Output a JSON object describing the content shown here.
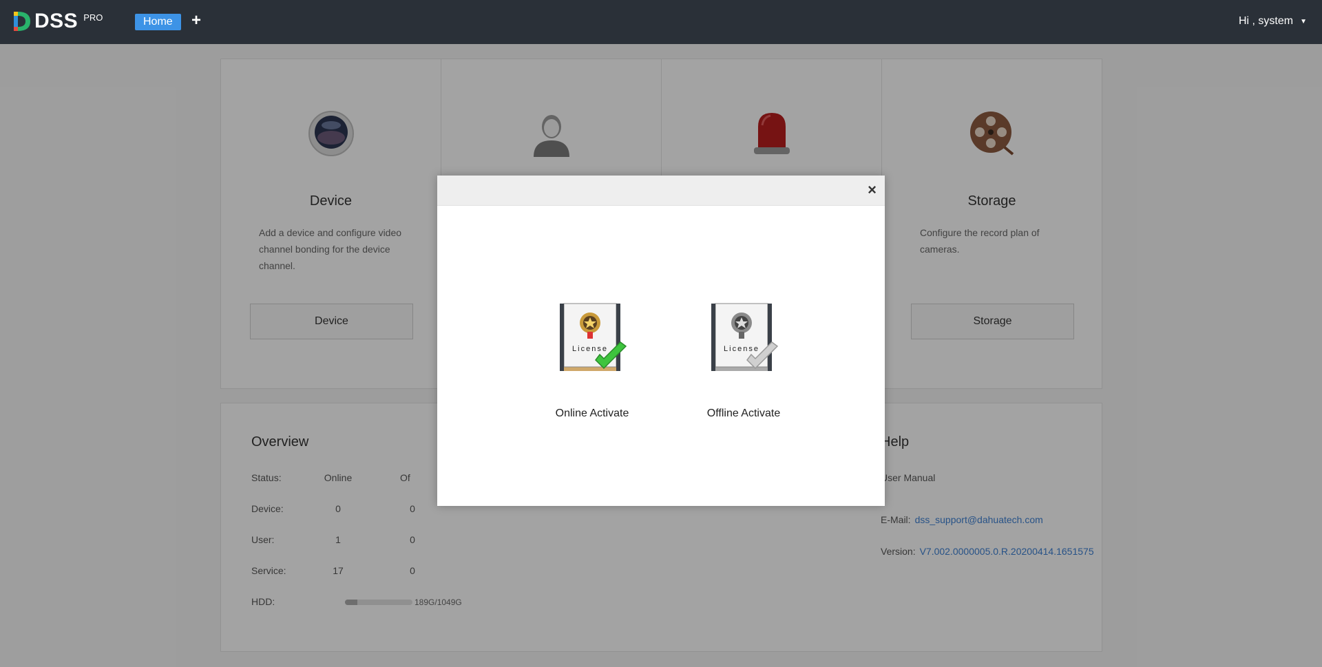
{
  "header": {
    "logo_text": "DSS",
    "logo_suffix": "PRO",
    "home_tab": "Home",
    "add_tab": "+",
    "user_greeting": "Hi , system"
  },
  "cards": [
    {
      "title": "Device",
      "desc": "Add a device and configure video channel bonding for the device channel.",
      "button": "Device",
      "icon": "camera-icon"
    },
    {
      "title": "",
      "desc": "",
      "button": "",
      "icon": "user-icon"
    },
    {
      "title": "",
      "desc": "",
      "button": "",
      "icon": "alarm-icon"
    },
    {
      "title": "Storage",
      "desc": "Configure the record plan of cameras.",
      "button": "Storage",
      "icon": "film-reel-icon"
    }
  ],
  "overview": {
    "title": "Overview",
    "col_online": "Online",
    "col_offline": "Of",
    "rows": [
      {
        "label": "Status:"
      },
      {
        "label": "Device:",
        "online": "0",
        "offline": "0"
      },
      {
        "label": "User:",
        "online": "1",
        "offline": "0"
      },
      {
        "label": "Service:",
        "online": "17",
        "offline": "0"
      },
      {
        "label": "HDD:"
      }
    ],
    "hdd_text": "189G/1049G",
    "hdd_fraction": 0.18
  },
  "help": {
    "title": "Help",
    "manual": "User Manual",
    "email_label": "E-Mail:",
    "email": "dss_support@dahuatech.com",
    "version_label": "Version:",
    "version": "V7.002.0000005.0.R.20200414.1651575"
  },
  "modal": {
    "close": "×",
    "online_label": "Online Activate",
    "offline_label": "Offline Activate",
    "license_text": "License"
  }
}
